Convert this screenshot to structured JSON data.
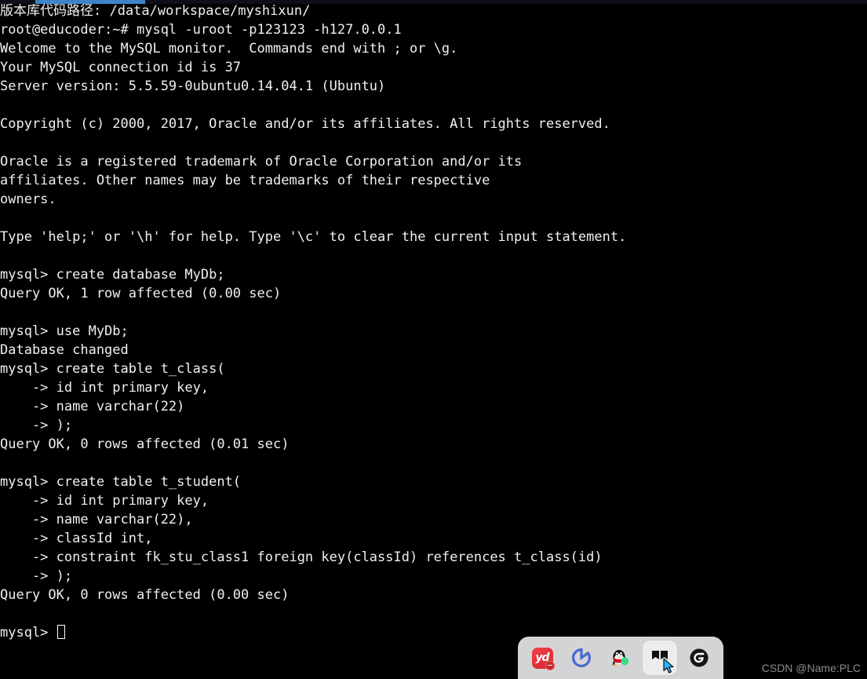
{
  "window": {
    "background": "#000000",
    "foreground": "#f0f0f0"
  },
  "terminal": {
    "lines": [
      "版本库代码路径: /data/workspace/myshixun/",
      "root@educoder:~# mysql -uroot -p123123 -h127.0.0.1",
      "Welcome to the MySQL monitor.  Commands end with ; or \\g.",
      "Your MySQL connection id is 37",
      "Server version: 5.5.59-0ubuntu0.14.04.1 (Ubuntu)",
      "",
      "Copyright (c) 2000, 2017, Oracle and/or its affiliates. All rights reserved.",
      "",
      "Oracle is a registered trademark of Oracle Corporation and/or its",
      "affiliates. Other names may be trademarks of their respective",
      "owners.",
      "",
      "Type 'help;' or '\\h' for help. Type '\\c' to clear the current input statement.",
      "",
      "mysql> create database MyDb;",
      "Query OK, 1 row affected (0.00 sec)",
      "",
      "mysql> use MyDb;",
      "Database changed",
      "mysql> create table t_class(",
      "    -> id int primary key,",
      "    -> name varchar(22)",
      "    -> );",
      "Query OK, 0 rows affected (0.01 sec)",
      "",
      "mysql> create table t_student(",
      "    -> id int primary key,",
      "    -> name varchar(22),",
      "    -> classId int,",
      "    -> constraint fk_stu_class1 foreign key(classId) references t_class(id)",
      "    -> );",
      "Query OK, 0 rows affected (0.00 sec)",
      ""
    ],
    "prompt": "mysql> ",
    "cursor": "block-hollow"
  },
  "dock": {
    "items": [
      {
        "name": "youdao-dictionary",
        "label": "yd",
        "active": false,
        "color": "#e23b43"
      },
      {
        "name": "browser",
        "label": "",
        "active": false,
        "color": "#4a69d4"
      },
      {
        "name": "qq",
        "label": "",
        "active": false,
        "color": "#000000"
      },
      {
        "name": "windows-start",
        "label": "",
        "active": true,
        "color": "#1a1a1a"
      },
      {
        "name": "logitech-options",
        "label": "",
        "active": false,
        "color": "#1a1a1a"
      }
    ],
    "background": "#d4d4d6"
  },
  "watermark": {
    "text": "CSDN @Name:PLC",
    "color": "#8d8d8d"
  }
}
